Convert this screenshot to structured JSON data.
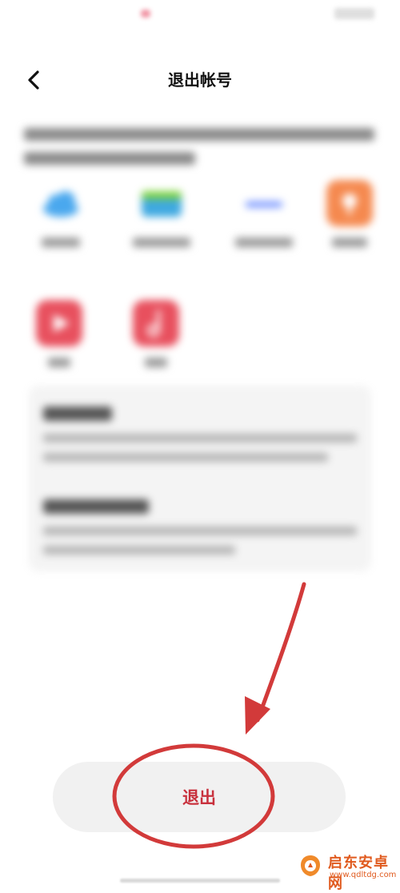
{
  "header": {
    "title": "退出帐号"
  },
  "logout": {
    "label": "退出"
  },
  "watermark": {
    "name": "启东安卓网",
    "url": "www.qdltdg.com"
  },
  "colors": {
    "accent_red": "#c8313d",
    "annotation_red": "#d23a3a",
    "watermark_orange": "#e05a1e"
  }
}
